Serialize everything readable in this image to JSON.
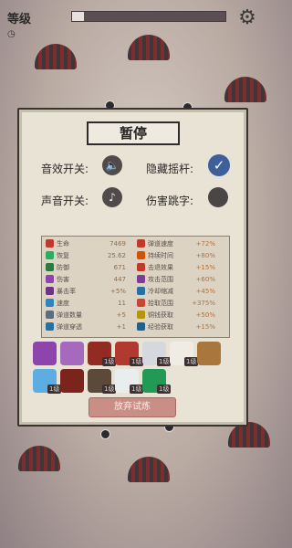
{
  "hud": {
    "level_label": "等级",
    "level_value": "",
    "progress": 0.08
  },
  "pause_panel": {
    "title": "暂停",
    "options": [
      {
        "label": "音效开关:",
        "state": "on",
        "icon": "speaker-icon"
      },
      {
        "label": "隐藏摇杆:",
        "state": "checked",
        "icon": "check-icon"
      },
      {
        "label": "声音开关:",
        "state": "on",
        "icon": "music-icon"
      },
      {
        "label": "伤害跳字:",
        "state": "off",
        "icon": ""
      }
    ],
    "stats_left": [
      {
        "name": "生命",
        "value": "7469",
        "color": "#c0392b"
      },
      {
        "name": "恢复",
        "value": "25.62",
        "color": "#27ae60"
      },
      {
        "name": "防御",
        "value": "671",
        "color": "#2c7a3f"
      },
      {
        "name": "伤害",
        "value": "447",
        "color": "#8e44ad"
      },
      {
        "name": "暴击率",
        "value": "+5%",
        "color": "#6c3483"
      },
      {
        "name": "速度",
        "value": "11",
        "color": "#2e86c1"
      },
      {
        "name": "弹道数量",
        "value": "+5",
        "color": "#5d6d7e"
      },
      {
        "name": "弹道穿透",
        "value": "+1",
        "color": "#2471a3"
      }
    ],
    "stats_right": [
      {
        "name": "弹道速度",
        "value": "+72%",
        "color": "#c0392b"
      },
      {
        "name": "持续时间",
        "value": "+80%",
        "color": "#d35400"
      },
      {
        "name": "击退效果",
        "value": "+15%",
        "color": "#c0392b"
      },
      {
        "name": "攻击范围",
        "value": "+60%",
        "color": "#7d3c98"
      },
      {
        "name": "冷却缩减",
        "value": "+45%",
        "color": "#2471a3"
      },
      {
        "name": "拾取范围",
        "value": "+375%",
        "color": "#cb4335"
      },
      {
        "name": "铜钱获取",
        "value": "+50%",
        "color": "#b7950b"
      },
      {
        "name": "经验获取",
        "value": "+15%",
        "color": "#1f618d"
      }
    ],
    "skills_row1": [
      {
        "icon": "purple-gourd-icon",
        "badge": ""
      },
      {
        "icon": "spirit-flower-icon",
        "badge": ""
      },
      {
        "icon": "red-fan-icon",
        "badge": "1级"
      },
      {
        "icon": "war-fan-icon",
        "badge": "1级"
      },
      {
        "icon": "yin-yang-icon",
        "badge": "1级"
      },
      {
        "icon": "boot-icon",
        "badge": "1级"
      },
      {
        "icon": "money-bag-icon",
        "badge": ""
      }
    ],
    "skills_row2": [
      {
        "icon": "ice-crystal-icon",
        "badge": "1级"
      },
      {
        "icon": "red-sword-icon",
        "badge": ""
      },
      {
        "icon": "teapot-icon",
        "badge": "1级"
      },
      {
        "icon": "white-flower-icon",
        "badge": "1级"
      },
      {
        "icon": "jade-ring-icon",
        "badge": "1级"
      }
    ],
    "give_up_label": "放弃试炼"
  }
}
